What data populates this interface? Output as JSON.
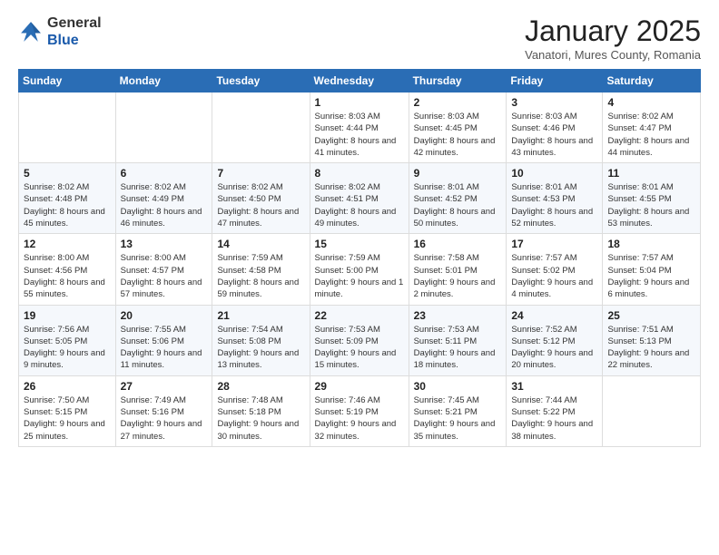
{
  "header": {
    "logo_general": "General",
    "logo_blue": "Blue",
    "month_title": "January 2025",
    "location": "Vanatori, Mures County, Romania"
  },
  "weekdays": [
    "Sunday",
    "Monday",
    "Tuesday",
    "Wednesday",
    "Thursday",
    "Friday",
    "Saturday"
  ],
  "weeks": [
    [
      {
        "day": "",
        "info": ""
      },
      {
        "day": "",
        "info": ""
      },
      {
        "day": "",
        "info": ""
      },
      {
        "day": "1",
        "info": "Sunrise: 8:03 AM\nSunset: 4:44 PM\nDaylight: 8 hours and 41 minutes."
      },
      {
        "day": "2",
        "info": "Sunrise: 8:03 AM\nSunset: 4:45 PM\nDaylight: 8 hours and 42 minutes."
      },
      {
        "day": "3",
        "info": "Sunrise: 8:03 AM\nSunset: 4:46 PM\nDaylight: 8 hours and 43 minutes."
      },
      {
        "day": "4",
        "info": "Sunrise: 8:02 AM\nSunset: 4:47 PM\nDaylight: 8 hours and 44 minutes."
      }
    ],
    [
      {
        "day": "5",
        "info": "Sunrise: 8:02 AM\nSunset: 4:48 PM\nDaylight: 8 hours and 45 minutes."
      },
      {
        "day": "6",
        "info": "Sunrise: 8:02 AM\nSunset: 4:49 PM\nDaylight: 8 hours and 46 minutes."
      },
      {
        "day": "7",
        "info": "Sunrise: 8:02 AM\nSunset: 4:50 PM\nDaylight: 8 hours and 47 minutes."
      },
      {
        "day": "8",
        "info": "Sunrise: 8:02 AM\nSunset: 4:51 PM\nDaylight: 8 hours and 49 minutes."
      },
      {
        "day": "9",
        "info": "Sunrise: 8:01 AM\nSunset: 4:52 PM\nDaylight: 8 hours and 50 minutes."
      },
      {
        "day": "10",
        "info": "Sunrise: 8:01 AM\nSunset: 4:53 PM\nDaylight: 8 hours and 52 minutes."
      },
      {
        "day": "11",
        "info": "Sunrise: 8:01 AM\nSunset: 4:55 PM\nDaylight: 8 hours and 53 minutes."
      }
    ],
    [
      {
        "day": "12",
        "info": "Sunrise: 8:00 AM\nSunset: 4:56 PM\nDaylight: 8 hours and 55 minutes."
      },
      {
        "day": "13",
        "info": "Sunrise: 8:00 AM\nSunset: 4:57 PM\nDaylight: 8 hours and 57 minutes."
      },
      {
        "day": "14",
        "info": "Sunrise: 7:59 AM\nSunset: 4:58 PM\nDaylight: 8 hours and 59 minutes."
      },
      {
        "day": "15",
        "info": "Sunrise: 7:59 AM\nSunset: 5:00 PM\nDaylight: 9 hours and 1 minute."
      },
      {
        "day": "16",
        "info": "Sunrise: 7:58 AM\nSunset: 5:01 PM\nDaylight: 9 hours and 2 minutes."
      },
      {
        "day": "17",
        "info": "Sunrise: 7:57 AM\nSunset: 5:02 PM\nDaylight: 9 hours and 4 minutes."
      },
      {
        "day": "18",
        "info": "Sunrise: 7:57 AM\nSunset: 5:04 PM\nDaylight: 9 hours and 6 minutes."
      }
    ],
    [
      {
        "day": "19",
        "info": "Sunrise: 7:56 AM\nSunset: 5:05 PM\nDaylight: 9 hours and 9 minutes."
      },
      {
        "day": "20",
        "info": "Sunrise: 7:55 AM\nSunset: 5:06 PM\nDaylight: 9 hours and 11 minutes."
      },
      {
        "day": "21",
        "info": "Sunrise: 7:54 AM\nSunset: 5:08 PM\nDaylight: 9 hours and 13 minutes."
      },
      {
        "day": "22",
        "info": "Sunrise: 7:53 AM\nSunset: 5:09 PM\nDaylight: 9 hours and 15 minutes."
      },
      {
        "day": "23",
        "info": "Sunrise: 7:53 AM\nSunset: 5:11 PM\nDaylight: 9 hours and 18 minutes."
      },
      {
        "day": "24",
        "info": "Sunrise: 7:52 AM\nSunset: 5:12 PM\nDaylight: 9 hours and 20 minutes."
      },
      {
        "day": "25",
        "info": "Sunrise: 7:51 AM\nSunset: 5:13 PM\nDaylight: 9 hours and 22 minutes."
      }
    ],
    [
      {
        "day": "26",
        "info": "Sunrise: 7:50 AM\nSunset: 5:15 PM\nDaylight: 9 hours and 25 minutes."
      },
      {
        "day": "27",
        "info": "Sunrise: 7:49 AM\nSunset: 5:16 PM\nDaylight: 9 hours and 27 minutes."
      },
      {
        "day": "28",
        "info": "Sunrise: 7:48 AM\nSunset: 5:18 PM\nDaylight: 9 hours and 30 minutes."
      },
      {
        "day": "29",
        "info": "Sunrise: 7:46 AM\nSunset: 5:19 PM\nDaylight: 9 hours and 32 minutes."
      },
      {
        "day": "30",
        "info": "Sunrise: 7:45 AM\nSunset: 5:21 PM\nDaylight: 9 hours and 35 minutes."
      },
      {
        "day": "31",
        "info": "Sunrise: 7:44 AM\nSunset: 5:22 PM\nDaylight: 9 hours and 38 minutes."
      },
      {
        "day": "",
        "info": ""
      }
    ]
  ]
}
